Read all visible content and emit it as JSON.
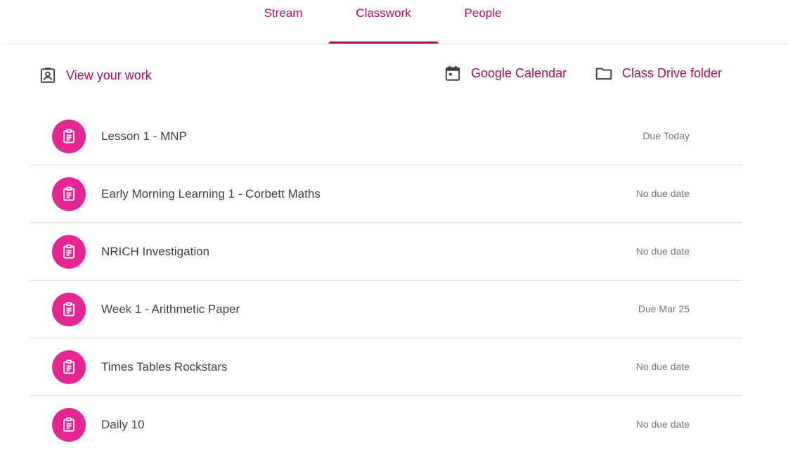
{
  "tabs": [
    {
      "label": "Stream",
      "active": false
    },
    {
      "label": "Classwork",
      "active": true
    },
    {
      "label": "People",
      "active": false
    }
  ],
  "actions": {
    "view_work": {
      "label": "View your work",
      "icon": "assignment-ind-icon"
    },
    "calendar": {
      "label": "Google Calendar",
      "icon": "calendar-icon"
    },
    "drive": {
      "label": "Class Drive folder",
      "icon": "folder-icon"
    }
  },
  "assignments": [
    {
      "title": "Lesson 1 - MNP",
      "due": "Due Today",
      "icon": "assignment-icon"
    },
    {
      "title": "Early Morning Learning 1 - Corbett Maths",
      "due": "No due date",
      "icon": "assignment-icon"
    },
    {
      "title": "NRICH Investigation",
      "due": "No due date",
      "icon": "assignment-icon"
    },
    {
      "title": "Week 1 - Arithmetic Paper",
      "due": "Due Mar 25",
      "icon": "assignment-icon"
    },
    {
      "title": "Times Tables Rockstars",
      "due": "No due date",
      "icon": "assignment-icon"
    },
    {
      "title": "Daily 10",
      "due": "No due date",
      "icon": "assignment-icon"
    }
  ],
  "colors": {
    "accent": "#a50e60",
    "accent_light": "#b8106a",
    "icon_bg": "#e52592",
    "divider": "#dadce0",
    "title_text": "#3c4043",
    "due_text": "#70757a"
  }
}
